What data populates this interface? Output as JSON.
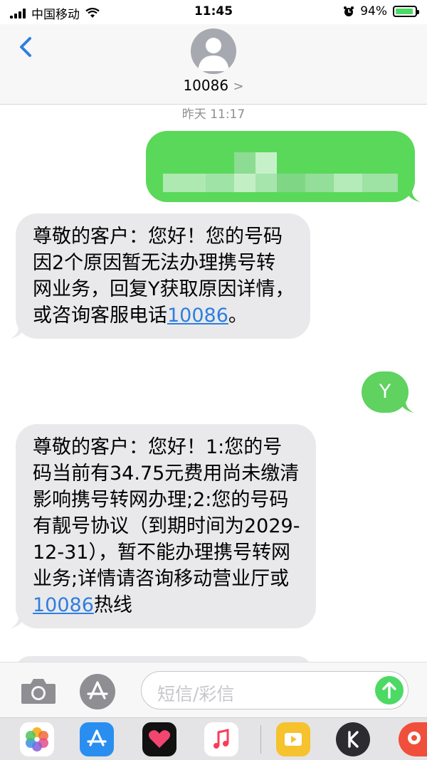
{
  "status_bar": {
    "carrier": "中国移动",
    "time": "11:45",
    "battery_percent": "94%",
    "battery_level": 0.94,
    "icons": [
      "signal-icon",
      "wifi-icon",
      "alarm-icon",
      "battery-icon"
    ]
  },
  "nav": {
    "back_icon": "chevron-left-icon",
    "contact_name": "10086",
    "contact_chevron": ">"
  },
  "thread": {
    "timestamp": "昨天 11:17",
    "messages": [
      {
        "from": "me",
        "kind": "blurred"
      },
      {
        "from": "them",
        "text_before": "尊敬的客户：您好！您的号码因2个原因暂无法办理携号转网业务，回复Y获取原因详情，或咨询客服电话",
        "link": "10086",
        "text_after": "。"
      },
      {
        "from": "me",
        "text": "Y"
      },
      {
        "from": "them",
        "text_before": "尊敬的客户：您好！1:您的号码当前有34.75元费用尚未缴清影响携号转网办理;2:您的号码有靓号协议（到期时间为2029-12-31），暂不能办理携号转网业务;详情请咨询移动营业厅或",
        "link": "10086",
        "text_after": "热线"
      }
    ]
  },
  "composer": {
    "placeholder": "短信/彩信",
    "camera_icon": "camera-icon",
    "apps_icon": "app-store-icon",
    "send_icon": "send-arrow-icon"
  },
  "dock": {
    "apps": [
      "photos-icon",
      "app-store-icon",
      "heart-app-icon",
      "music-icon",
      "video-app-icon",
      "k-app-icon",
      "more-app-icon"
    ]
  },
  "colors": {
    "incoming_bubble": "#e9e9eb",
    "outgoing_bubble": "#5fd25f",
    "link": "#2f7ee0",
    "accent_blue": "#2f7ee0"
  }
}
